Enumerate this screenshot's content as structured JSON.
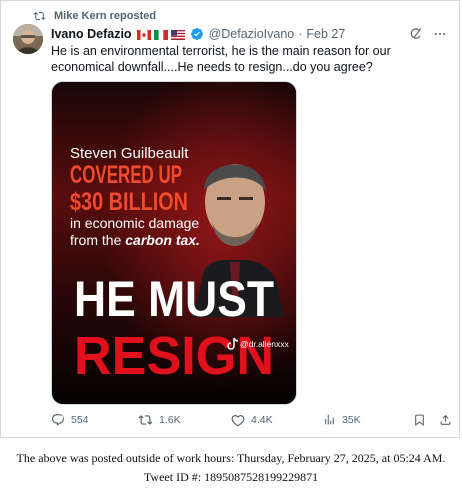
{
  "repost": {
    "text": "Mike Kern reposted"
  },
  "tweet": {
    "author_name": "Ivano Defazio",
    "handle": "@DefazioIvano",
    "separator": "·",
    "date": "Feb 27",
    "text": "He is an environmental terrorist, he is the main reason for our economical downfall....He needs to resign...do you agree?",
    "flags": [
      "canada-flag",
      "italy-flag",
      "usa-flag"
    ]
  },
  "media": {
    "line1": "Steven Guilbeault",
    "line2": "COVERED UP",
    "line3": "$30 BILLION",
    "line4": "in economic damage",
    "line5_prefix": "from the ",
    "line5_emph": "carbon tax.",
    "big1": "HE MUST",
    "big2": "RESIGN",
    "watermark": "@dr.alienxxx"
  },
  "actions": {
    "replies": "554",
    "reposts": "1.6K",
    "likes": "4.4K",
    "views": "35K"
  },
  "colors": {
    "accent": "#1d9bf0",
    "muted": "#536471",
    "poster_red": "#e0101c"
  },
  "footer": {
    "line1": "The above was posted outside of work hours: Thursday, February 27, 2025, at 05:24 AM.",
    "line2": "Tweet ID #: 1895087528199229871"
  }
}
